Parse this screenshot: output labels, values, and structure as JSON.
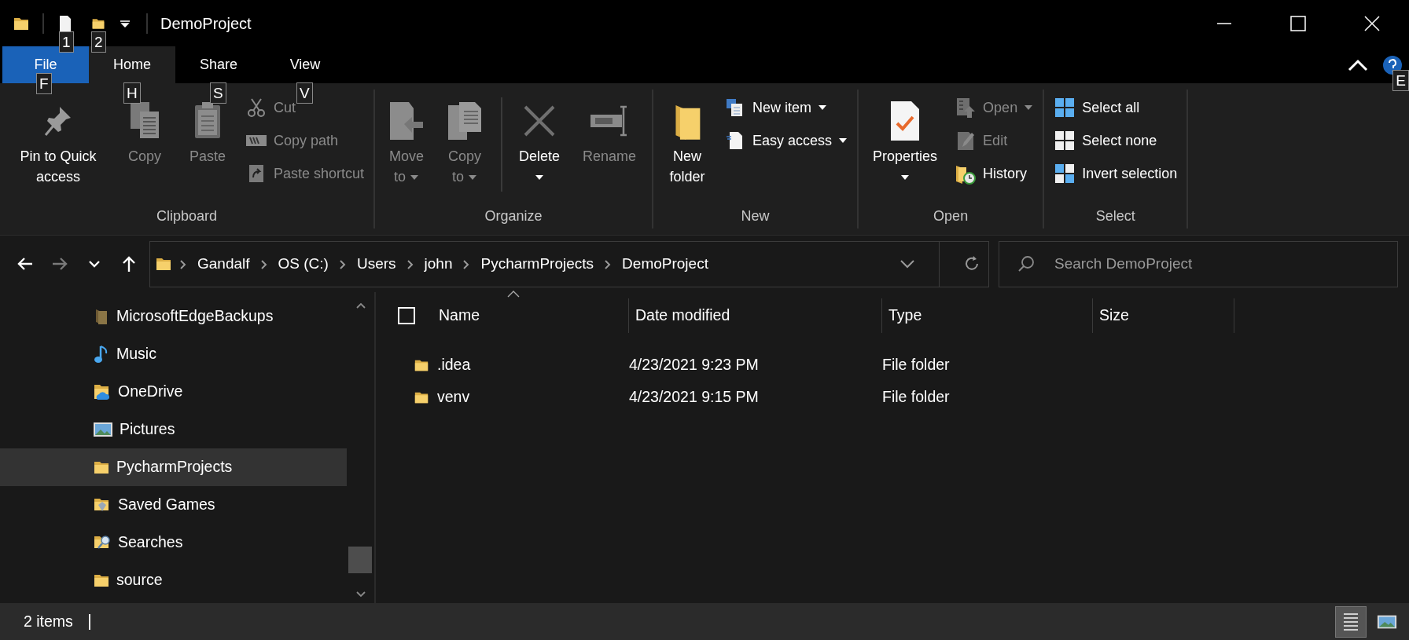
{
  "title_bar": {
    "title": "DemoProject",
    "quick_access_keytips": [
      "1",
      "2"
    ]
  },
  "ribbon_tabs": [
    {
      "label": "File",
      "kind": "file",
      "selected": false,
      "keytip": "F"
    },
    {
      "label": "Home",
      "kind": "tab",
      "selected": true,
      "keytip": "H"
    },
    {
      "label": "Share",
      "kind": "tab",
      "selected": false,
      "keytip": "S"
    },
    {
      "label": "View",
      "kind": "tab",
      "selected": false,
      "keytip": "V"
    }
  ],
  "help_keytip": "E",
  "ribbon_groups": [
    {
      "label": "Clipboard",
      "items": [
        {
          "kind": "large",
          "label": "Pin to Quick access",
          "disabled": false,
          "dropdown": false
        },
        {
          "kind": "large",
          "label": "Copy",
          "disabled": true,
          "dropdown": false
        },
        {
          "kind": "large",
          "label": "Paste",
          "disabled": true,
          "dropdown": false
        },
        {
          "kind": "small",
          "label": "Cut",
          "disabled": true,
          "dropdown": false
        },
        {
          "kind": "small",
          "label": "Copy path",
          "disabled": true,
          "dropdown": false
        },
        {
          "kind": "small",
          "label": "Paste shortcut",
          "disabled": true,
          "dropdown": false
        }
      ]
    },
    {
      "label": "Organize",
      "items": [
        {
          "kind": "large",
          "label": "Move to",
          "disabled": true,
          "dropdown": true
        },
        {
          "kind": "large",
          "label": "Copy to",
          "disabled": true,
          "dropdown": true
        },
        {
          "kind": "separator"
        },
        {
          "kind": "large",
          "label": "Delete",
          "disabled": false,
          "dropdown": true
        },
        {
          "kind": "large",
          "label": "Rename",
          "disabled": true,
          "dropdown": false
        }
      ]
    },
    {
      "label": "New",
      "items": [
        {
          "kind": "large",
          "label": "New folder",
          "disabled": false,
          "dropdown": false
        },
        {
          "kind": "small",
          "label": "New item",
          "disabled": false,
          "dropdown": true
        },
        {
          "kind": "small",
          "label": "Easy access",
          "disabled": false,
          "dropdown": true
        }
      ]
    },
    {
      "label": "Open",
      "items": [
        {
          "kind": "large",
          "label": "Properties",
          "disabled": false,
          "dropdown": true
        },
        {
          "kind": "small",
          "label": "Open",
          "disabled": true,
          "dropdown": true
        },
        {
          "kind": "small",
          "label": "Edit",
          "disabled": true,
          "dropdown": false
        },
        {
          "kind": "small",
          "label": "History",
          "disabled": false,
          "dropdown": false
        }
      ]
    },
    {
      "label": "Select",
      "items": [
        {
          "kind": "small",
          "label": "Select all",
          "disabled": false,
          "dropdown": false
        },
        {
          "kind": "small",
          "label": "Select none",
          "disabled": false,
          "dropdown": false
        },
        {
          "kind": "small",
          "label": "Invert selection",
          "disabled": false,
          "dropdown": false
        }
      ]
    }
  ],
  "nav_buttons": [
    {
      "kind": "back",
      "disabled": false
    },
    {
      "kind": "forward",
      "disabled": true
    },
    {
      "kind": "recent",
      "disabled": false
    },
    {
      "kind": "up",
      "disabled": false
    }
  ],
  "breadcrumb": [
    "Gandalf",
    "OS (C:)",
    "Users",
    "john",
    "PycharmProjects",
    "DemoProject"
  ],
  "search": {
    "placeholder": "Search DemoProject"
  },
  "nav_pane": {
    "items": [
      {
        "label": "MicrosoftEdgeBackups",
        "kind": "hidden",
        "selected": false
      },
      {
        "label": "Music",
        "kind": "music",
        "selected": false
      },
      {
        "label": "OneDrive",
        "kind": "onedrive",
        "selected": false
      },
      {
        "label": "Pictures",
        "kind": "pictures",
        "selected": false
      },
      {
        "label": "PycharmProjects",
        "kind": "folder",
        "selected": true
      },
      {
        "label": "Saved Games",
        "kind": "games",
        "selected": false
      },
      {
        "label": "Searches",
        "kind": "searches",
        "selected": false
      },
      {
        "label": "source",
        "kind": "folder",
        "selected": false
      }
    ]
  },
  "file_list": {
    "header_checkbox": {
      "checked": false
    },
    "columns": [
      {
        "label": "Name",
        "sorted": true
      },
      {
        "label": "Date modified",
        "sorted": false
      },
      {
        "label": "Type",
        "sorted": false
      },
      {
        "label": "Size",
        "sorted": false
      }
    ],
    "rows": [
      {
        "name": ".idea",
        "date_modified": "4/23/2021 9:23 PM",
        "type": "File folder",
        "selected": false
      },
      {
        "name": "venv",
        "date_modified": "4/23/2021 9:15 PM",
        "type": "File folder",
        "selected": false
      }
    ]
  },
  "status_bar": {
    "item_count": "2 items",
    "views": [
      {
        "kind": "details",
        "selected": true
      },
      {
        "kind": "large_icons",
        "selected": false
      }
    ]
  }
}
